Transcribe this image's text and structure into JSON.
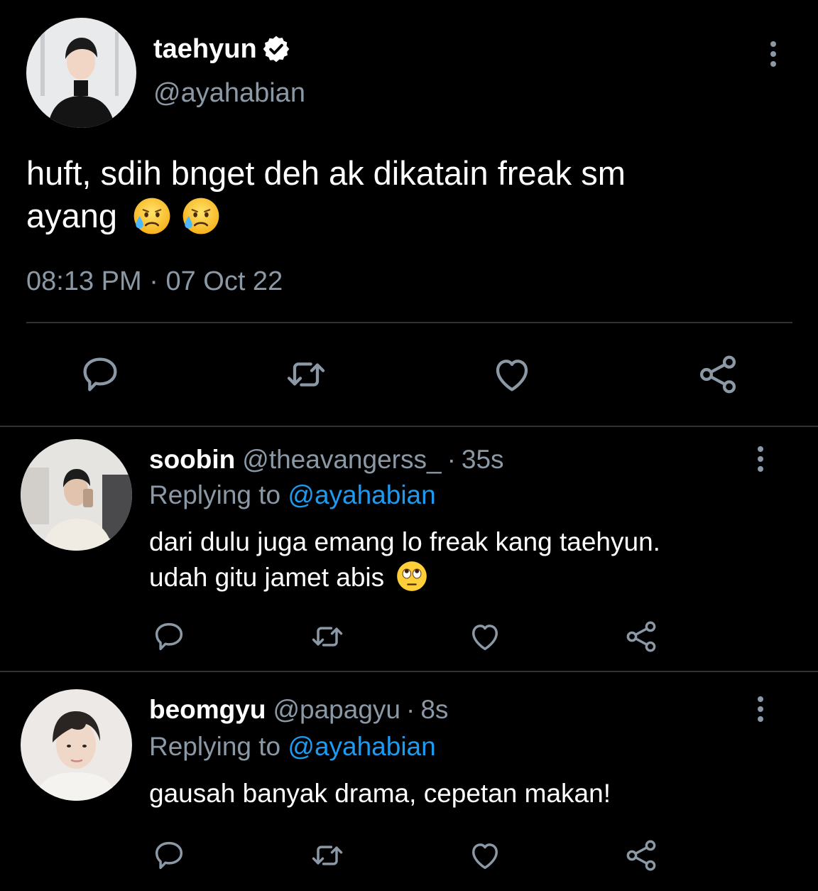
{
  "main_tweet": {
    "display_name": "taehyun",
    "handle": "@ayahabian",
    "text_line1": "huft, sdih bnget deh ak dikatain freak sm",
    "text_line2": "ayang",
    "emojis": [
      "sad-but-relieved-face",
      "sad-but-relieved-face"
    ],
    "time": "08:13 PM",
    "separator": "·",
    "date": "07 Oct 22",
    "verified": true,
    "avatar": "avatar-taehyun"
  },
  "replies": [
    {
      "display_name": "soobin",
      "handle": "@theavangerss_",
      "separator": "·",
      "time": "35s",
      "replying_prefix": "Replying to",
      "replying_to": "@ayahabian",
      "text_line1": "dari dulu juga emang lo freak kang taehyun.",
      "text_line2": "udah gitu jamet abis",
      "emoji": "face-with-rolling-eyes",
      "avatar": "avatar-soobin"
    },
    {
      "display_name": "beomgyu",
      "handle": "@papagyu",
      "separator": "·",
      "time": "8s",
      "replying_prefix": "Replying to",
      "replying_to": "@ayahabian",
      "text_line1": "gausah banyak drama, cepetan makan!",
      "avatar": "avatar-beomgyu"
    }
  ],
  "icons": {
    "reply": "reply-icon",
    "retweet": "retweet-icon",
    "like": "like-icon",
    "share": "share-icon",
    "more": "more-options-icon",
    "verified": "verified-badge-icon"
  },
  "colors": {
    "background": "#000000",
    "primary_text": "#ffffff",
    "secondary_text": "#8b98a5",
    "link": "#1d9bf0",
    "divider": "#2f3336"
  }
}
